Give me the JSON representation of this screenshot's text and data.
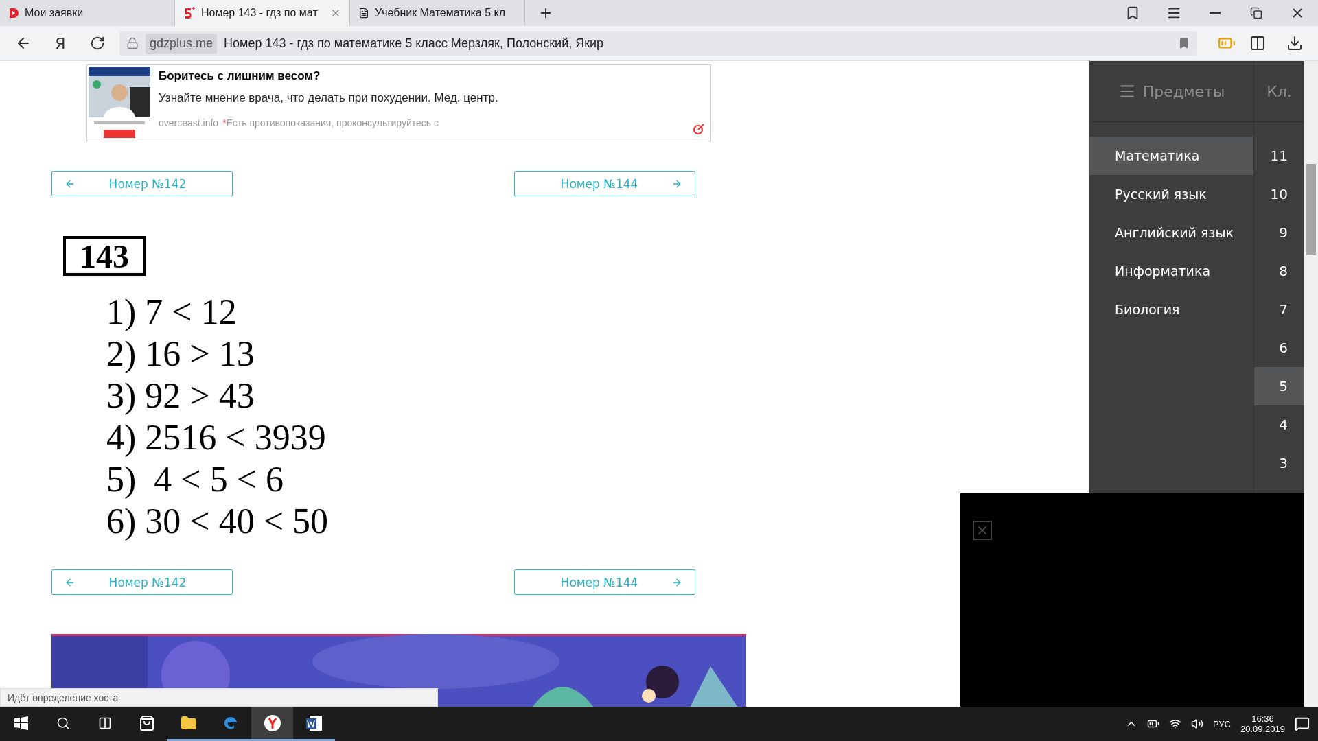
{
  "browser": {
    "tabs": [
      {
        "title": "Мои заявки",
        "kind": "service",
        "selected": false
      },
      {
        "title": "Номер 143 - гдз по мат",
        "kind": "site",
        "selected": true
      },
      {
        "title": "Учебник Математика 5 кл",
        "kind": "page",
        "selected": false
      }
    ],
    "home_key": "Я",
    "domain": "gdzplus.me",
    "page_title": "Номер 143 - гдз по математике 5 класс Мерзляк, Полонский, Якир"
  },
  "ad": {
    "title": "Боритесь с лишним весом?",
    "text": "Узнайте мнение врача, что делать при похудении. Мед. центр.",
    "source": "overceast.info",
    "mark": "*",
    "disclaimer": "Есть противопоказания, проконсультируйтесь с"
  },
  "nav_top": {
    "prev": "Номер №142",
    "next": "Номер №144"
  },
  "problem": {
    "number": "143",
    "lines": [
      "1) 7 < 12",
      "2) 16 > 13",
      "3) 92 > 43",
      "4) 2516 < 3939",
      "5)  4 < 5 < 6",
      "6) 30 < 40 < 50"
    ]
  },
  "nav_bottom": {
    "prev": "Номер №142",
    "next": "Номер №144"
  },
  "sidebar": {
    "title": "Предметы",
    "grade_header": "Кл.",
    "subjects": [
      {
        "label": "Математика",
        "selected": true
      },
      {
        "label": "Русский язык",
        "selected": false
      },
      {
        "label": "Английский язык",
        "selected": false
      },
      {
        "label": "Информатика",
        "selected": false
      },
      {
        "label": "Биология",
        "selected": false
      }
    ],
    "grades": [
      {
        "label": "11",
        "selected": false
      },
      {
        "label": "10",
        "selected": false
      },
      {
        "label": "9",
        "selected": false
      },
      {
        "label": "8",
        "selected": false
      },
      {
        "label": "7",
        "selected": false
      },
      {
        "label": "6",
        "selected": false
      },
      {
        "label": "5",
        "selected": true
      },
      {
        "label": "4",
        "selected": false
      },
      {
        "label": "3",
        "selected": false
      }
    ]
  },
  "status_bar": "Идёт определение хоста",
  "taskbar": {
    "apps": [
      {
        "kind": "store",
        "running": false,
        "selected": false
      },
      {
        "kind": "explorer",
        "running": true,
        "selected": false
      },
      {
        "kind": "edge",
        "running": true,
        "selected": false
      },
      {
        "kind": "yandex",
        "running": true,
        "selected": true
      },
      {
        "kind": "word",
        "running": true,
        "selected": false
      }
    ],
    "language": "РУС",
    "time": "16:36",
    "date": "20.09.2019"
  }
}
